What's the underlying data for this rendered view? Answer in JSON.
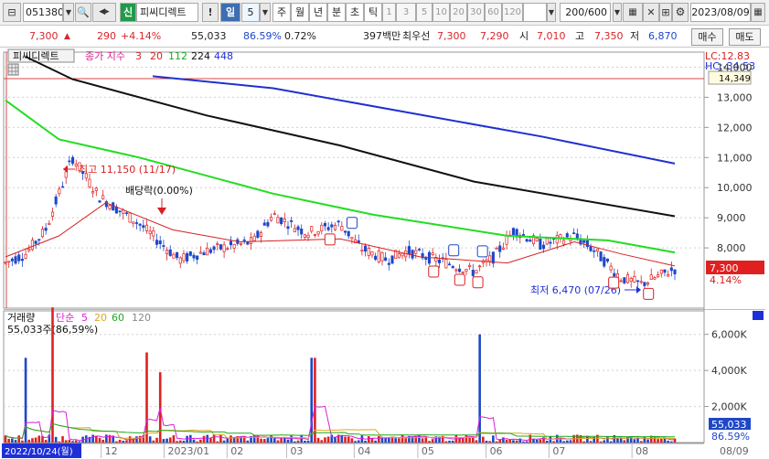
{
  "toolbar": {
    "code": "051380",
    "badge": "신",
    "name": "피씨디렉트",
    "period_active": "일",
    "period_num": "5",
    "periods": [
      "주",
      "월",
      "년",
      "분",
      "초",
      "틱"
    ],
    "minutes": [
      "1",
      "3",
      "5",
      "10",
      "20",
      "30",
      "60",
      "120"
    ],
    "count": "200/600",
    "date": "2023/08/09",
    "colors": {
      "active": "#3d6fb0",
      "badge": "#1f9a4a"
    }
  },
  "quote": {
    "price": "7,300",
    "change": "290",
    "change_pct": "+4.14%",
    "volume": "55,033",
    "vol_ratio": "86.59%",
    "turnover_pct": "0.72%",
    "amount": "397백만",
    "best_label": "최우선",
    "ask": "7,300",
    "bid": "7,290",
    "open_label": "시",
    "open": "7,010",
    "high_label": "고",
    "high": "7,350",
    "low_label": "저",
    "low": "6,870",
    "buy_button": "매수",
    "sell_button": "매도"
  },
  "chart": {
    "title": "피씨디렉트",
    "ma_label": "종가 지수",
    "ma_periods": [
      "3",
      "20",
      "112",
      "224",
      "448"
    ],
    "ma_colors": [
      "#d82020",
      "#d82020",
      "#1fd81f",
      "#111111",
      "#1f2fd8"
    ],
    "lc": "LC:12.83",
    "hc": "HC:-34.53",
    "hline_label": "14,349",
    "price_tag": "7,300",
    "pct_tag": "4.14%",
    "high_note": "최고 11,150 (11/17)",
    "low_note": "최저 6,470 (07/26)",
    "div_note": "배당락(0.00%)",
    "y_ticks": [
      "14,000",
      "13,000",
      "12,000",
      "11,000",
      "10,000",
      "9,000",
      "8,000"
    ],
    "vol_title": "거래량",
    "vol_ma_label": "단순",
    "vol_ma_periods": [
      "5",
      "20",
      "60",
      "120"
    ],
    "vol_ma_colors": [
      "#d81fd8",
      "#d8a81f",
      "#1fa81f",
      "#888888"
    ],
    "vol_info": "55,033주(86,59%)",
    "vol_ticks": [
      "6,000K",
      "4,000K",
      "2,000K"
    ],
    "vol_tag": "55,033",
    "vol_pct_tag": "86.59%",
    "date_tag": "2022/10/24(월)",
    "x_ticks": [
      "12",
      "2023/01",
      "02",
      "03",
      "04",
      "05",
      "06",
      "07",
      "08"
    ],
    "x_end": "08/09"
  },
  "chart_data": {
    "type": "candlestick",
    "ylim": [
      6000,
      14500
    ],
    "x_range": [
      "2022-10-24",
      "2023-08-09"
    ],
    "ma448": [
      [
        0.03,
        14349
      ],
      [
        0.1,
        13600
      ],
      [
        0.3,
        12400
      ],
      [
        0.5,
        11400
      ],
      [
        0.7,
        10200
      ],
      [
        1.0,
        9050
      ]
    ],
    "ma224": [
      [
        0.22,
        13700
      ],
      [
        0.4,
        13300
      ],
      [
        0.6,
        12500
      ],
      [
        0.8,
        11700
      ],
      [
        1.0,
        10800
      ]
    ],
    "ma112": [
      [
        0.0,
        12900
      ],
      [
        0.08,
        11600
      ],
      [
        0.2,
        11000
      ],
      [
        0.4,
        9800
      ],
      [
        0.55,
        9100
      ],
      [
        0.75,
        8400
      ],
      [
        0.9,
        8250
      ],
      [
        1.0,
        7850
      ]
    ],
    "ma20": [
      [
        0.0,
        7700
      ],
      [
        0.08,
        8400
      ],
      [
        0.15,
        9500
      ],
      [
        0.25,
        8600
      ],
      [
        0.35,
        8200
      ],
      [
        0.5,
        8300
      ],
      [
        0.62,
        7700
      ],
      [
        0.75,
        7500
      ],
      [
        0.85,
        8200
      ],
      [
        0.92,
        7800
      ],
      [
        1.0,
        7400
      ]
    ],
    "closes": [
      [
        0.0,
        7500
      ],
      [
        0.03,
        7800
      ],
      [
        0.06,
        8600
      ],
      [
        0.1,
        11000
      ],
      [
        0.14,
        9700
      ],
      [
        0.2,
        8800
      ],
      [
        0.26,
        7600
      ],
      [
        0.3,
        7900
      ],
      [
        0.37,
        8200
      ],
      [
        0.4,
        9100
      ],
      [
        0.45,
        8500
      ],
      [
        0.5,
        8800
      ],
      [
        0.53,
        8000
      ],
      [
        0.57,
        7600
      ],
      [
        0.6,
        7900
      ],
      [
        0.66,
        7500
      ],
      [
        0.7,
        7200
      ],
      [
        0.73,
        7700
      ],
      [
        0.76,
        8600
      ],
      [
        0.8,
        8100
      ],
      [
        0.85,
        8400
      ],
      [
        0.88,
        7900
      ],
      [
        0.92,
        7000
      ],
      [
        0.95,
        6800
      ],
      [
        1.0,
        7300
      ]
    ],
    "high": {
      "value": 11150,
      "date": "11/17"
    },
    "low": {
      "value": 6470,
      "date": "07/26"
    },
    "last": 7300,
    "volume_ylim": [
      0,
      7000
    ],
    "volume_spikes_k": [
      [
        0.03,
        4700
      ],
      [
        0.07,
        7500
      ],
      [
        0.21,
        5000
      ],
      [
        0.23,
        3900
      ],
      [
        0.46,
        4700
      ],
      [
        0.71,
        6000
      ]
    ],
    "last_volume": 55033
  }
}
